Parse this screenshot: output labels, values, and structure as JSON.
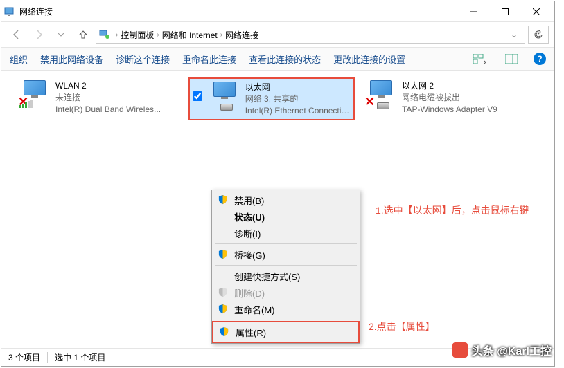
{
  "window": {
    "title": "网络连接"
  },
  "breadcrumb": {
    "seg1": "控制面板",
    "seg2": "网络和 Internet",
    "seg3": "网络连接"
  },
  "toolbar": {
    "organize": "组织",
    "disable": "禁用此网络设备",
    "diagnose": "诊断这个连接",
    "rename": "重命名此连接",
    "status": "查看此连接的状态",
    "change": "更改此连接的设置"
  },
  "connections": [
    {
      "name": "WLAN 2",
      "status": "未连接",
      "device": "Intel(R) Dual Band Wireles..."
    },
    {
      "name": "以太网",
      "status": "网络 3, 共享的",
      "device": "Intel(R) Ethernet Connectio..."
    },
    {
      "name": "以太网 2",
      "status": "网络电缆被拔出",
      "device": "TAP-Windows Adapter V9"
    }
  ],
  "context_menu": {
    "disable": "禁用(B)",
    "status": "状态(U)",
    "diagnose": "诊断(I)",
    "bridge": "桥接(G)",
    "shortcut": "创建快捷方式(S)",
    "delete": "删除(D)",
    "rename": "重命名(M)",
    "properties": "属性(R)"
  },
  "annotations": {
    "step1": "1.选中【以太网】后，点击鼠标右键",
    "step2": "2.点击【属性】"
  },
  "statusbar": {
    "count": "3 个项目",
    "selected": "选中 1 个项目"
  },
  "watermark": {
    "text": "头条 @Karl工控"
  }
}
